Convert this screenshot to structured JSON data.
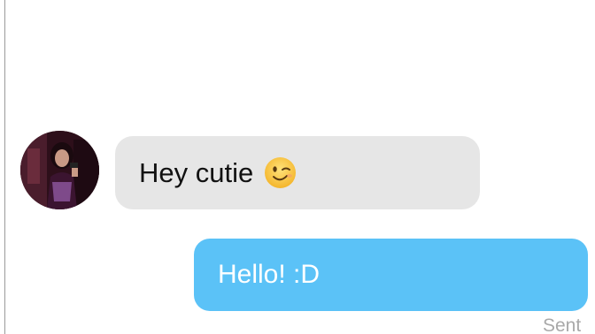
{
  "conversation": {
    "incoming": {
      "text": "Hey cutie",
      "emoji": "winking-face-emoji"
    },
    "outgoing": {
      "text": "Hello! :D",
      "status": "Sent"
    }
  },
  "colors": {
    "incoming_bubble": "#e6e6e6",
    "outgoing_bubble": "#5bc2f7",
    "status_text": "#a9a9a9"
  }
}
